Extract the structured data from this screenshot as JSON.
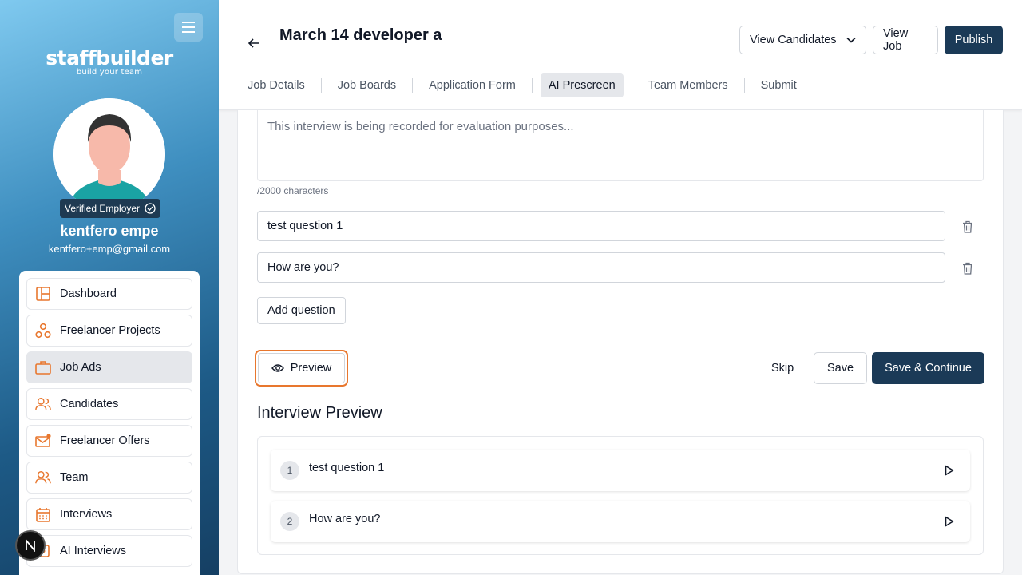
{
  "sidebar": {
    "logo_text": "staffbuilder",
    "logo_tagline": "build your team",
    "badge_label": "Verified Employer",
    "user_name": "kentfero empe",
    "user_email": "kentfero+emp@gmail.com",
    "items": [
      {
        "label": "Dashboard",
        "icon": "dashboard-icon"
      },
      {
        "label": "Freelancer Projects",
        "icon": "projects-icon"
      },
      {
        "label": "Job Ads",
        "icon": "briefcase-icon",
        "active": true
      },
      {
        "label": "Candidates",
        "icon": "users-icon"
      },
      {
        "label": "Freelancer Offers",
        "icon": "mail-icon"
      },
      {
        "label": "Team",
        "icon": "team-icon"
      },
      {
        "label": "Interviews",
        "icon": "calendar-icon"
      },
      {
        "label": "AI Interviews",
        "icon": "ai-icon"
      }
    ],
    "floating_badge": "N"
  },
  "header": {
    "title": "March 14 developer a",
    "view_candidates": "View Candidates",
    "view_job": "View Job",
    "publish": "Publish",
    "tabs": [
      {
        "label": "Job Details"
      },
      {
        "label": "Job Boards"
      },
      {
        "label": "Application Form"
      },
      {
        "label": "AI Prescreen",
        "active": true
      },
      {
        "label": "Team Members"
      },
      {
        "label": "Submit"
      }
    ]
  },
  "form": {
    "intro_placeholder": "This interview is being recorded for evaluation purposes...",
    "char_count": "/2000 characters",
    "questions": [
      "test question 1",
      "How are you?"
    ],
    "add_question": "Add question",
    "preview": "Preview",
    "skip": "Skip",
    "save": "Save",
    "save_continue": "Save & Continue"
  },
  "preview": {
    "title": "Interview Preview",
    "items": [
      {
        "num": "1",
        "text": "test question 1"
      },
      {
        "num": "2",
        "text": "How are you?"
      }
    ]
  },
  "colors": {
    "accent": "#e8772e",
    "primary": "#1b3a57"
  }
}
